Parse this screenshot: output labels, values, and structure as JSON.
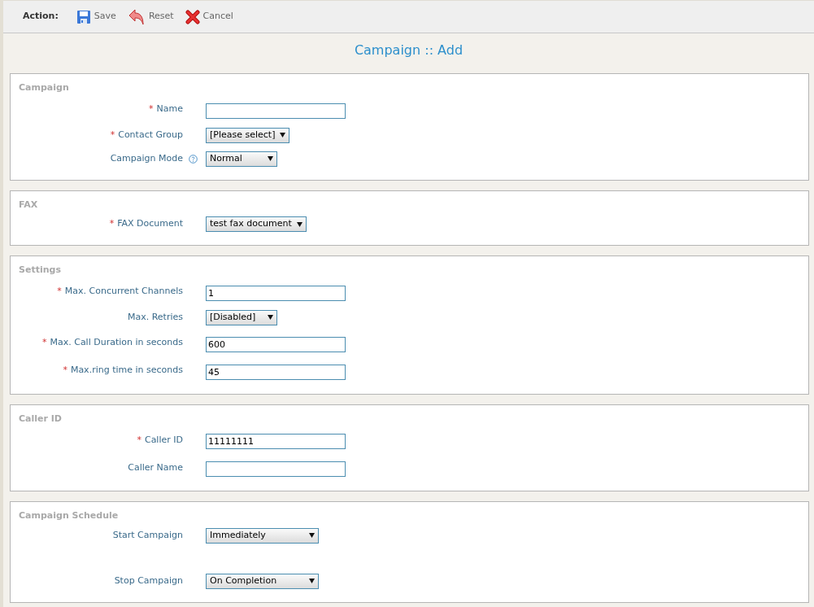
{
  "toolbar": {
    "label": "Action:",
    "buttons": [
      {
        "kind": "save",
        "label": "Save"
      },
      {
        "kind": "reset",
        "label": "Reset"
      },
      {
        "kind": "cancel",
        "label": "Cancel"
      }
    ]
  },
  "title": "Campaign :: Add",
  "sections": [
    {
      "title": "Campaign",
      "fields": [
        {
          "mark": "*",
          "label": "Name",
          "kind": "text"
        },
        {
          "mark": "*",
          "label": "Contact Group",
          "kind": "select",
          "value": "[Please select]"
        },
        {
          "label": "Campaign Mode",
          "help": true,
          "kind": "select",
          "value": "Normal"
        }
      ]
    },
    {
      "title": "FAX",
      "fields": [
        {
          "mark": "*",
          "label": "FAX Document",
          "kind": "select",
          "value": "test fax document"
        }
      ]
    },
    {
      "title": "Settings",
      "fields": [
        {
          "mark": "*",
          "label": "Max. Concurrent Channels",
          "kind": "text",
          "value": "1"
        },
        {
          "label": "Max. Retries",
          "kind": "select",
          "value": "[Disabled]"
        },
        {
          "mark": "*",
          "label": "Max. Call Duration in seconds",
          "kind": "text",
          "value": "600"
        },
        {
          "mark": "*",
          "label": "Max.ring time in seconds",
          "kind": "text",
          "value": "45"
        }
      ]
    },
    {
      "title": "Caller ID",
      "fields": [
        {
          "mark": "*",
          "label": "Caller ID",
          "kind": "text",
          "value": "11111111"
        },
        {
          "label": "Caller Name",
          "kind": "text"
        }
      ]
    },
    {
      "title": "Campaign Schedule",
      "fields": [
        {
          "label": "Start Campaign",
          "kind": "wide-select",
          "value": "Immediately"
        },
        {
          "label": "Stop Campaign",
          "kind": "wide-select",
          "value": "On Completion"
        }
      ]
    }
  ]
}
